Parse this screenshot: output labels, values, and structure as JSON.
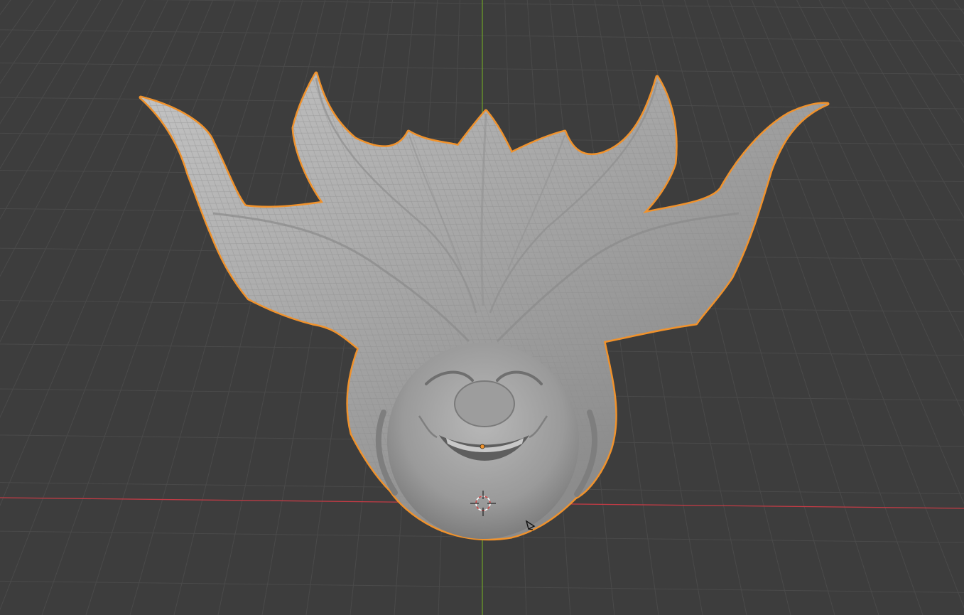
{
  "viewport": {
    "background_color": "#3d3d3d",
    "grid_color": "#4a4a4a",
    "x_axis_color": "#c23b45",
    "y_axis_color": "#6b9a2b",
    "selection_outline_color": "#f0922c",
    "mesh_color": "#a6a6a6",
    "origin_dot_color": "#f0922c"
  },
  "scene": {
    "object_kind": "sculpted mesh",
    "selected": true,
    "icons": [
      "3d-cursor-icon",
      "light-icon",
      "object-origin-icon"
    ]
  }
}
